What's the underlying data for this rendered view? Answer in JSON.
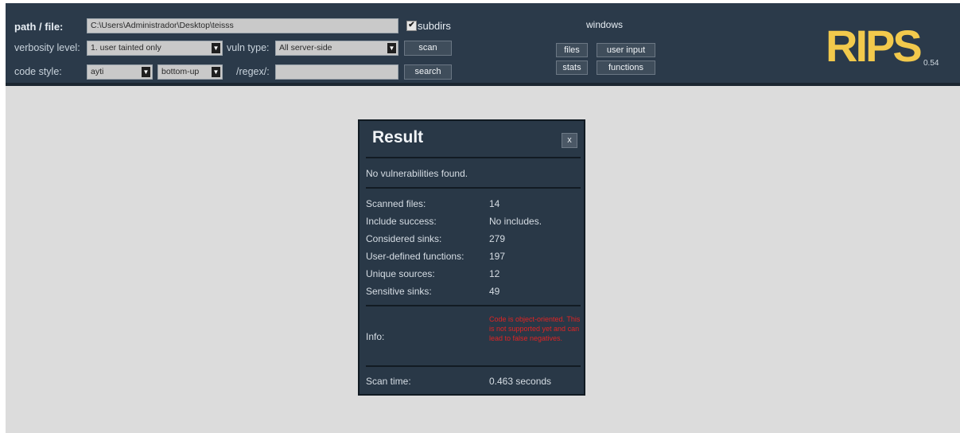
{
  "toolbar": {
    "path_label": "path / file:",
    "path_value": "C:\\Users\\Administrador\\Desktop\\teisss",
    "subdirs_label": "subdirs",
    "subdirs_checked": "✔",
    "verbosity_label": "verbosity level:",
    "verbosity_value": "1. user tainted only",
    "vuln_label": "vuln type:",
    "vuln_value": "All server-side",
    "scan_label": "scan",
    "code_style_label": "code style:",
    "code_style_value": "ayti",
    "order_value": "bottom-up",
    "regex_label": "/regex/:",
    "regex_value": "",
    "search_label": "search"
  },
  "windows": {
    "heading": "windows",
    "files_label": "files",
    "user_input_label": "user input",
    "stats_label": "stats",
    "functions_label": "functions"
  },
  "logo": {
    "text": "RIPS",
    "version": "0.54",
    "color": "#f2c94c"
  },
  "result": {
    "title": "Result",
    "close_label": "x",
    "summary": "No vulnerabilities found.",
    "stats": [
      {
        "label": "Scanned files:",
        "value": "14"
      },
      {
        "label": "Include success:",
        "value": "No includes."
      },
      {
        "label": "Considered sinks:",
        "value": "279"
      },
      {
        "label": "User-defined functions:",
        "value": "197"
      },
      {
        "label": "Unique sources:",
        "value": "12"
      },
      {
        "label": "Sensitive sinks:",
        "value": "49"
      }
    ],
    "info_label": "Info:",
    "info_text": "Code is object-oriented. This is not supported yet and can lead to false negatives.",
    "scan_time_label": "Scan time:",
    "scan_time_value": "0.463 seconds"
  },
  "colors": {
    "header_bg": "#2b3a4a",
    "dialog_bg": "#293847",
    "warning": "#e02424"
  }
}
